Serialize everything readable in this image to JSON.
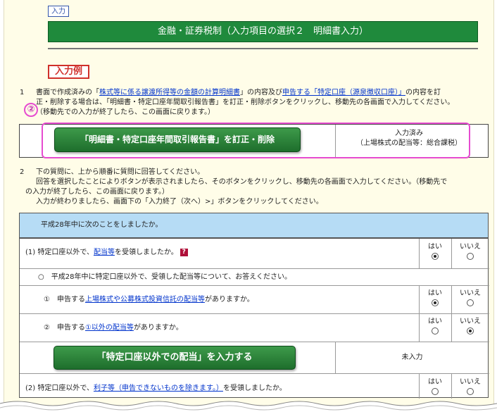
{
  "header": {
    "input_tag": "入力",
    "title": "金融・証券税制（入力項目の選択２　明細書入力）",
    "example_tag": "入力例"
  },
  "section1": {
    "num": "1",
    "line1_pre": "書面で作成済みの「",
    "link1": "株式等に係る譲渡所得等の金額の計算明細書",
    "line1_mid": "」の内容及び",
    "link2": "申告する「特定口座（源泉徴収口座）」",
    "line1_post": "の内容を訂",
    "line2": "正・削除する場合は、「明細書・特定口座年間取引報告書」を訂正・削除ボタンをクリックし、移動先の各画面で入力してください。",
    "line3": "（移動先での入力が終了したら、この画面に戻ります。）",
    "callout_num": "②",
    "button": "「明細書・特定口座年間取引報告書」を訂正・削除",
    "status_line1": "入力済み",
    "status_line2": "（上場株式の配当等：総合課税）"
  },
  "section2": {
    "num": "2",
    "line1": "下の質問に、上から順番に質問に回答してください。",
    "line2": "回答を選択したことによりボタンが表示されましたら、そのボタンをクリックし、移動先の各画面で入力してください。（移動先で",
    "line3": "の入力が終了したら、この画面に戻ります。）",
    "line4": "入力が終わりましたら、画面下の「入力終了（次へ）>」ボタンをクリックしてください。"
  },
  "year_header": "平成28年中に次のことをしましたか。",
  "yes_label": "はい",
  "no_label": "いいえ",
  "q1": {
    "pre": "(1) 特定口座以外で、",
    "link": "配当等",
    "post": "を受領しましたか。",
    "help_icon": "?",
    "answer": "yes"
  },
  "q1_sub_header": "○　平成28年中に特定口座以外で、受領した配当等について、お答えください。",
  "q1_a": {
    "pre": "①　申告する",
    "link": "上場株式や公募株式投資信託の配当等",
    "post": "がありますか。",
    "answer": "yes"
  },
  "q1_b": {
    "pre": "②　申告する",
    "link": "①以外の配当等",
    "post": "がありますか。",
    "answer": "no"
  },
  "dividend_button": "「特定口座以外での配当」を入力する",
  "dividend_status": "未入力",
  "q2": {
    "pre": "(2) 特定口座以外で、",
    "link": "利子等（申告できないものを除きます。）",
    "post": "を受領しましたか。"
  }
}
